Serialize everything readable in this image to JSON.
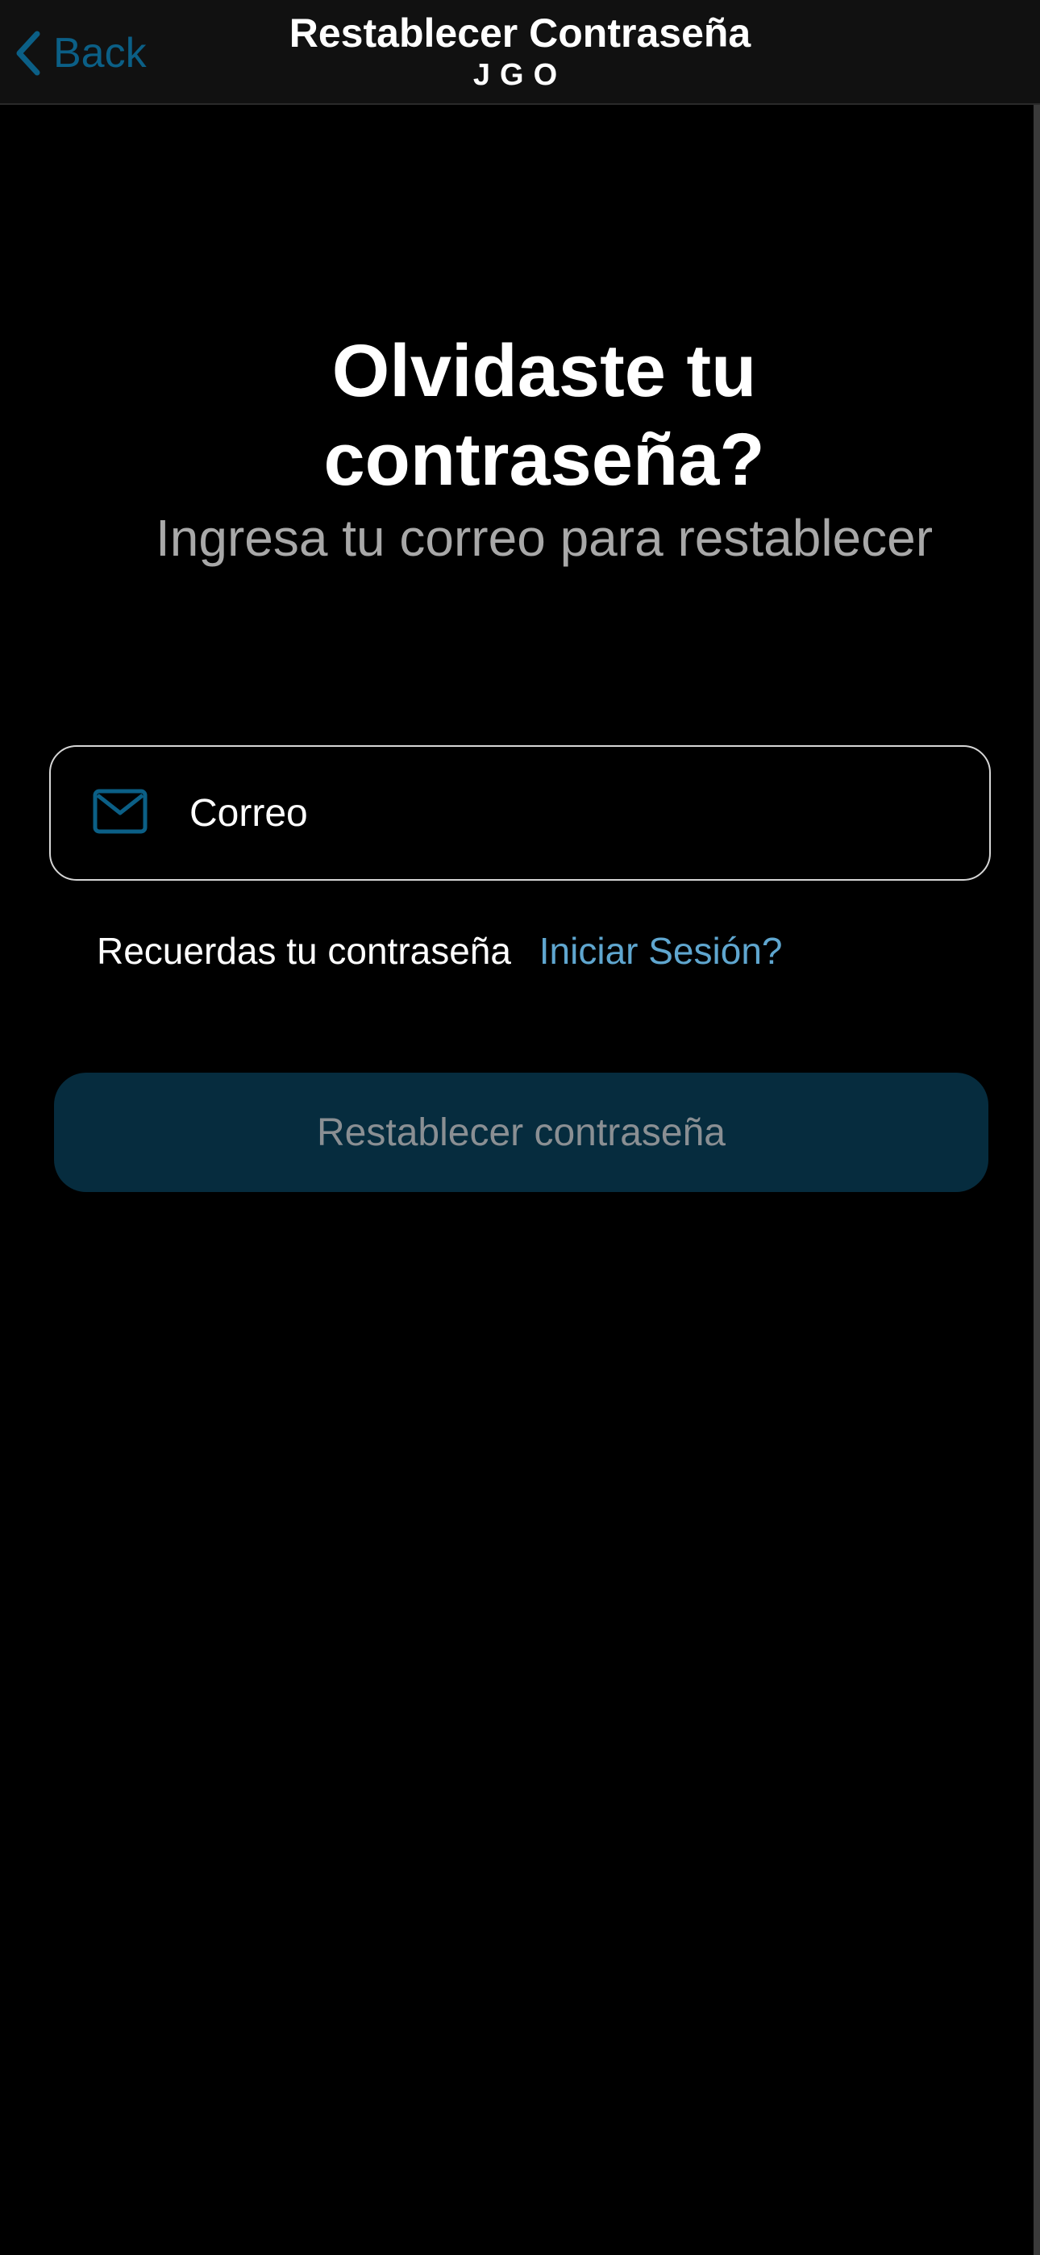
{
  "nav": {
    "back_label": "Back",
    "title": "Restablecer Contraseña",
    "subtitle": "JGO",
    "back_icon": "chevron-left-icon"
  },
  "main": {
    "headline_line1": "Olvidaste tu",
    "headline_line2": "contraseña?",
    "lead": "Ingresa tu correo para restablecer"
  },
  "email": {
    "placeholder": "Correo",
    "value": "",
    "icon": "mail-icon"
  },
  "remember": {
    "text": "Recuerdas tu contraseña",
    "link": "Iniciar Sesión?"
  },
  "reset_button": {
    "label": "Restablecer contraseña"
  },
  "colors": {
    "accent": "#0b5f86",
    "link": "#5fa6cf",
    "button_bg": "#062c3e",
    "button_text": "#8a8f93",
    "background": "#000000"
  }
}
